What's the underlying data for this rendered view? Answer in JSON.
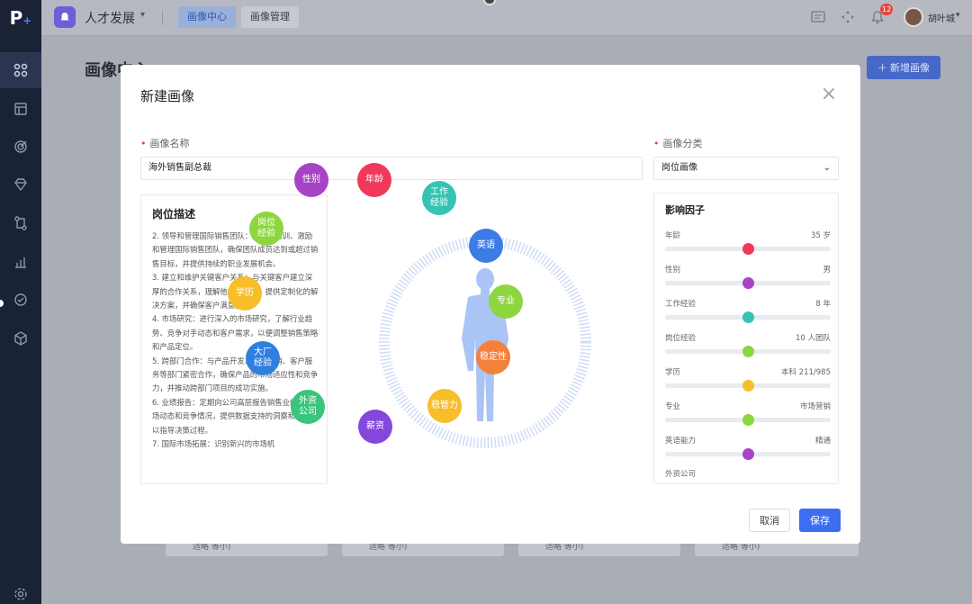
{
  "sidebar": {
    "logo_text": "P",
    "logo_plus": "+",
    "items": [
      {
        "icon": "grid-icon"
      },
      {
        "icon": "table-icon"
      },
      {
        "icon": "target-icon"
      },
      {
        "icon": "diamond-icon"
      },
      {
        "icon": "flow-icon"
      },
      {
        "icon": "chart-icon"
      },
      {
        "icon": "badge-icon"
      },
      {
        "icon": "cube-icon"
      },
      {
        "icon": "settings-icon"
      }
    ]
  },
  "topbar": {
    "app_name": "人才发展",
    "tabs": [
      {
        "label": "画像中心",
        "active": true
      },
      {
        "label": "画像管理",
        "active": false
      }
    ],
    "notification_count": "12",
    "user_name": "胡叶城"
  },
  "page": {
    "title": "画像中心",
    "add_button": "新增画像",
    "card_footers": [
      "适略  等小)",
      "适略  等小)",
      "适略  等小)",
      "适略  等小)"
    ]
  },
  "modal": {
    "title": "新建画像",
    "name_label": "画像名称",
    "name_value": "海外销售副总裁",
    "category_label": "画像分类",
    "category_value": "岗位画像",
    "description": {
      "title": "岗位描述",
      "paragraphs": [
        "2. 领导和管理国际销售团队：招聘、培训、激励和管理国际销售团队，确保团队成员达到或超过销售目标，并提供持续的职业发展机会。",
        "3. 建立和维护关键客户关系：与关键客户建立深厚的合作关系，理解他们的需求，提供定制化的解决方案，并确保客户满意度。",
        "4. 市场研究：进行深入的市场研究，了解行业趋势、竞争对手动态和客户需求，以便调整销售策略和产品定位。",
        "5. 跨部门合作：与产品开发、市场营销、客户服务等部门紧密合作，确保产品的市场适应性和竞争力，并推动跨部门项目的成功实施。",
        "6. 业绩报告：定期向公司高层报告销售业绩、市场动态和竞争情况，提供数据支持的洞察和建议，以指导决策过程。",
        "7. 国际市场拓展：识别新兴的市场机"
      ]
    },
    "bubbles": [
      {
        "label": "年龄",
        "color": "#f2385a"
      },
      {
        "label": "工作\n经验",
        "color": "#35c3b3"
      },
      {
        "label": "英语",
        "color": "#3d7ce5"
      },
      {
        "label": "专业",
        "color": "#8dd63e"
      },
      {
        "label": "稳定性",
        "color": "#f4803a"
      },
      {
        "label": "稳管力",
        "color": "#f7be2a"
      },
      {
        "label": "薪资",
        "color": "#8447dc"
      },
      {
        "label": "外资\n公司",
        "color": "#3bc47b"
      },
      {
        "label": "大厂\n经验",
        "color": "#2f7fe0"
      },
      {
        "label": "学历",
        "color": "#f7be2a"
      },
      {
        "label": "岗位\n经验",
        "color": "#8dd63e"
      },
      {
        "label": "性别",
        "color": "#a744c6"
      }
    ],
    "factors": {
      "title": "影响因子",
      "items": [
        {
          "name": "年龄",
          "value": "35 岁",
          "level": 0.5,
          "color": "#f2385a"
        },
        {
          "name": "性别",
          "value": "男",
          "level": 0.5,
          "color": "#a744c6"
        },
        {
          "name": "工作经验",
          "value": "8 年",
          "level": 0.5,
          "color": "#35c3b3"
        },
        {
          "name": "岗位经验",
          "value": "10 人团队",
          "level": 0.5,
          "color": "#8dd63e"
        },
        {
          "name": "学历",
          "value": "本科 211/985",
          "level": 0.5,
          "color": "#f7be2a"
        },
        {
          "name": "专业",
          "value": "市场营销",
          "level": 0.5,
          "color": "#8dd63e"
        },
        {
          "name": "英语能力",
          "value": "精通",
          "level": 0.5,
          "color": "#a744c6"
        }
      ],
      "last_item": "外资公司"
    },
    "cancel_label": "取消",
    "save_label": "保存"
  },
  "colors": {
    "primary": "#3d6ef0",
    "sidebar_bg": "#1a2236",
    "figure": "#a9c4f5"
  }
}
